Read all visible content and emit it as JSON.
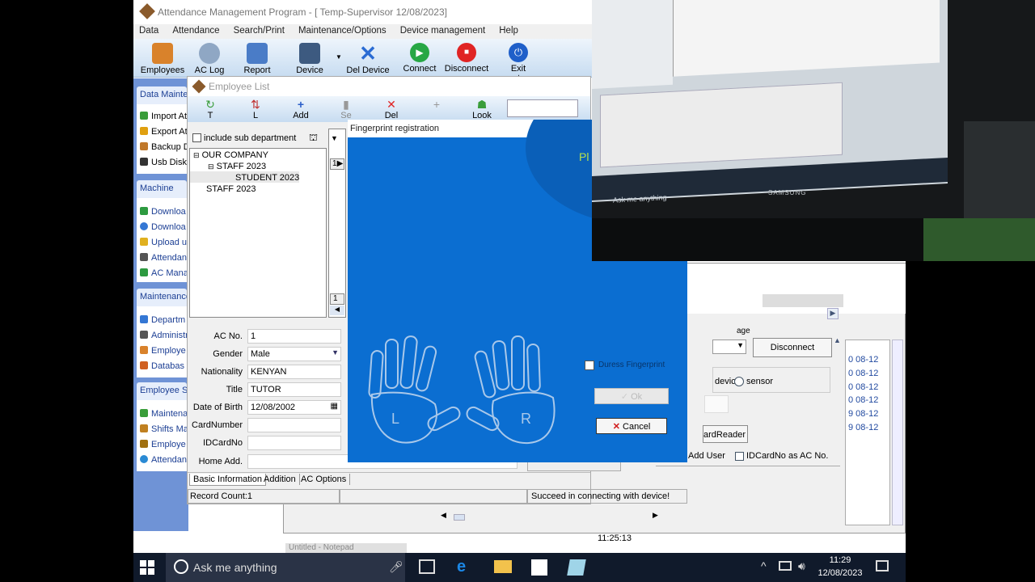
{
  "app": {
    "title": "Attendance Management Program - [ Temp-Supervisor 12/08/2023]",
    "menu": [
      "Data",
      "Attendance",
      "Search/Print",
      "Maintenance/Options",
      "Device management",
      "Help"
    ],
    "toolbar": [
      {
        "label": "Employees",
        "icon": "employees-icon",
        "color": "#d9822b"
      },
      {
        "label": "AC Log",
        "icon": "clock-icon",
        "color": "#8fa7c4"
      },
      {
        "label": "Report",
        "icon": "report-icon",
        "color": "#4a7cc7"
      },
      {
        "label": "Device",
        "icon": "device-icon",
        "color": "#3d5a80"
      },
      {
        "label": "Del Device",
        "icon": "x-icon",
        "color": "#2a6bd3"
      },
      {
        "label": "Connect",
        "icon": "play-icon",
        "color": "#27a745"
      },
      {
        "label": "Disconnect",
        "icon": "stop-icon",
        "color": "#e02424"
      },
      {
        "label": "Exit system",
        "icon": "power-icon",
        "color": "#1f5fc9"
      }
    ]
  },
  "left_panel": {
    "sections": [
      {
        "title": "Data Mainten",
        "items": [
          "Import At",
          "Export At",
          "Backup D",
          "Usb Disk"
        ]
      },
      {
        "title": "Machine",
        "items": [
          "Downloa",
          "Downloa",
          "Upload u",
          "Attendan",
          "AC Mana"
        ]
      },
      {
        "title": "Maintenance",
        "items": [
          "Departm",
          "Administr",
          "Employe",
          "Databas"
        ]
      },
      {
        "title": "Employee Sc",
        "items": [
          "Maintena",
          "Shifts Ma",
          "Employe",
          "Attendan"
        ]
      }
    ]
  },
  "employee_list": {
    "title": "Employee List",
    "toolbar": [
      "T",
      "L",
      "Add",
      "Se",
      "Del",
      "",
      "Look"
    ],
    "include_sub": "include sub department",
    "tree": [
      {
        "label": "OUR COMPANY",
        "level": 0
      },
      {
        "label": "STAFF 2023",
        "level": 1
      },
      {
        "label": "STUDENT 2023",
        "level": 2
      },
      {
        "label": "STAFF 2023",
        "level": 0
      }
    ],
    "grid_row_marker": "1",
    "grid_row_num": "1",
    "form": {
      "ac_no_label": "AC No.",
      "ac_no": "1",
      "gender_label": "Gender",
      "gender": "Male",
      "nationality_label": "Nationality",
      "nationality": "KENYAN",
      "title_label": "Title",
      "title": "TUTOR",
      "dob_label": "Date of Birth",
      "dob": "12/08/2002",
      "card_label": "CardNumber",
      "card": "",
      "idcard_label": "IDCardNo",
      "idcard": "",
      "home_label": "Home Add.",
      "home": ""
    },
    "tabs": [
      "Basic Information",
      "Addition",
      "AC Options"
    ],
    "record_count": "Record Count:1",
    "status": "Succeed in connecting with device!"
  },
  "fingerprint": {
    "title": "Fingerprint registration",
    "left_hand": "L",
    "right_hand": "R",
    "duress": "Duress Fingerprint",
    "ok": "Ok",
    "cancel": "Cancel",
    "corner_text": "Pl"
  },
  "bg_window": {
    "disconnect": "Disconnect",
    "sensor": "sensor",
    "device": "device",
    "card_reader": "ardReader",
    "add_user": "Add User",
    "idcard_as_ac": "IDCardNo as AC No.",
    "age_label": "age",
    "time": "11:25:13",
    "dates": [
      "0 08-12",
      "0 08-12",
      "0 08-12",
      "0 08-12",
      "9 08-12",
      "9 08-12"
    ]
  },
  "taskbar": {
    "search_placeholder": "Ask me anything",
    "time": "11:29",
    "date": "12/08/2023",
    "notepad": "Untitled - Notepad"
  },
  "camera": {
    "monitor_brand": "SAMSUNG",
    "search": "Ask me anything"
  }
}
